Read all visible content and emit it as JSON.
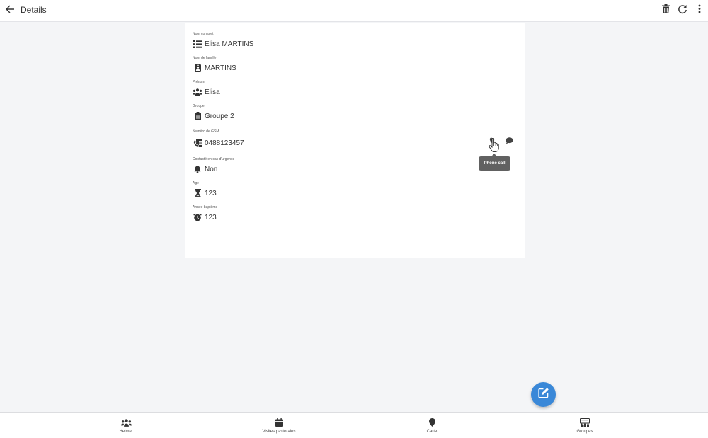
{
  "header": {
    "title": "Details",
    "back_icon": "arrow-left-icon",
    "actions": [
      "trash-icon",
      "refresh-icon",
      "more-vertical-icon"
    ]
  },
  "fields": [
    {
      "label": "Nom complet",
      "value": "Elisa MARTINS",
      "icon": "list-icon"
    },
    {
      "label": "Nom de famille",
      "value": "MARTINS",
      "icon": "id-badge-icon"
    },
    {
      "label": "Prénom",
      "value": "Elisa",
      "icon": "users-icon"
    },
    {
      "label": "Groupe",
      "value": "Groupe 2",
      "icon": "clipboard-icon"
    },
    {
      "label": "Numéro de GSM",
      "value": "0488123457",
      "icon": "phone-book-icon"
    },
    {
      "label": "Contacté en cas d'urgence",
      "value": "Non",
      "icon": "bell-icon"
    },
    {
      "label": "Age",
      "value": "123",
      "icon": "hourglass-icon"
    },
    {
      "label": "Année baptême",
      "value": "123",
      "icon": "alarm-clock-icon"
    }
  ],
  "gsm_actions": {
    "tooltip": "Phone call",
    "icons": [
      "phone-icon",
      "message-icon"
    ]
  },
  "fab": {
    "icon": "edit-icon"
  },
  "bottom_nav": [
    {
      "label": "Helmet",
      "icon": "users-icon"
    },
    {
      "label": "Visites pastorales",
      "icon": "calendar-icon"
    },
    {
      "label": "Carte",
      "icon": "map-marker-icon"
    },
    {
      "label": "Groupes",
      "icon": "groups-icon"
    }
  ],
  "colors": {
    "fab": "#3a88d8",
    "background": "#f4f5f7",
    "card": "#ffffff",
    "tooltip": "#616161"
  }
}
